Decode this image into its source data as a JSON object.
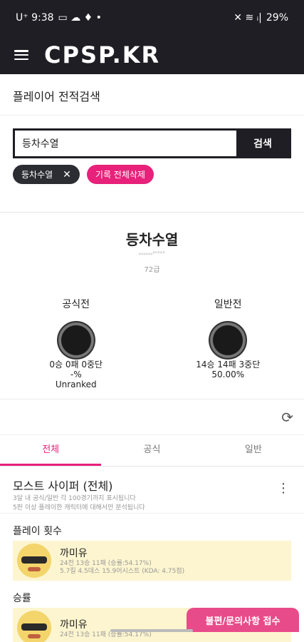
{
  "status_bar": {
    "carrier_time": "U⁺ 9:38",
    "left_icons": "▭ ☁ ♦ •",
    "right_icons": "✕ ≋ ᵢ|",
    "battery": "29%"
  },
  "app_bar": {
    "logo": "CPSP.KR"
  },
  "page_title": "플레이어 전적검색",
  "search": {
    "input_value": "등차수열",
    "button_label": "검색",
    "history_chip": "등차수열",
    "delete_all_label": "기록 전체삭제"
  },
  "profile": {
    "nickname": "등차수열",
    "sub_id": "ᵤᵤᵤᵤᵤᵤᵖᵖᵖᵖᵖ",
    "level": "72급",
    "official": {
      "title": "공식전",
      "record": "0승 0패 0중단",
      "rate": "-%",
      "tier": "Unranked"
    },
    "normal": {
      "title": "일반전",
      "record": "14승 14패 3중단",
      "rate": "50.00%"
    }
  },
  "tabs": [
    {
      "label": "전체"
    },
    {
      "label": "공식"
    },
    {
      "label": "일반"
    }
  ],
  "most_cypher": {
    "title": "모스트 사이퍼 (전체)",
    "desc1": "3달 내 공식/일반 각 100경기까지 표시됩니다",
    "desc2": "5판 이상 플레이한 캐릭터에 대해서만 분석됩니다"
  },
  "play_count": {
    "label": "플레이 횟수",
    "name": "까미유",
    "line1": "24전 13승 11패 (승률:54.17%)",
    "line2": "5.7킬 4.5데스 15.9어시스트 (KDA: 4.75점)"
  },
  "win_rate": {
    "label": "승률",
    "name": "까미유",
    "line1": "24전 13승 11패 (승률:54.17%)"
  },
  "floating_button": "불편/문의사항 접수"
}
